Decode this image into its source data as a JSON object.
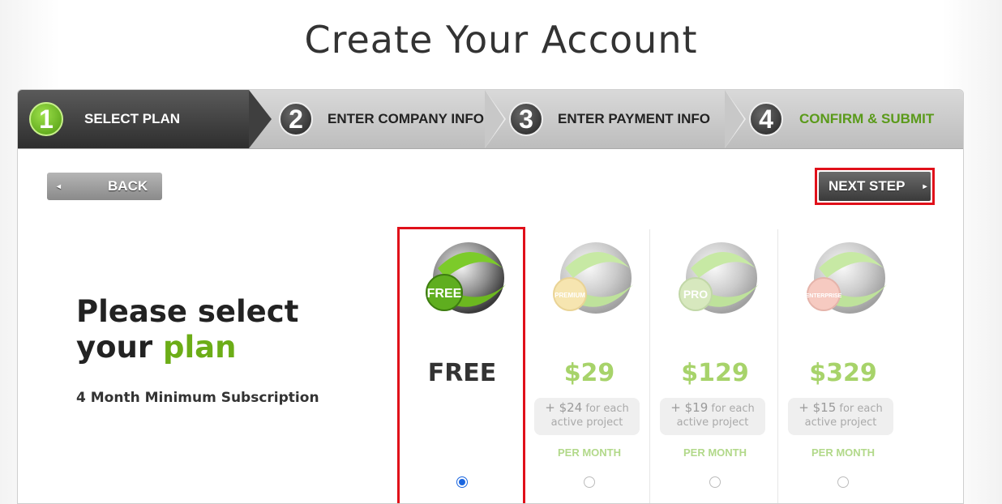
{
  "page": {
    "title": "Create Your Account"
  },
  "steps": [
    {
      "number": "1",
      "label": "SELECT PLAN",
      "state": "active"
    },
    {
      "number": "2",
      "label": "ENTER COMPANY INFO",
      "state": "pending"
    },
    {
      "number": "3",
      "label": "ENTER PAYMENT INFO",
      "state": "pending"
    },
    {
      "number": "4",
      "label": "CONFIRM & SUBMIT",
      "state": "final"
    }
  ],
  "nav": {
    "back_label": "BACK",
    "next_label": "NEXT STEP"
  },
  "intro": {
    "line1": "Please select",
    "line2_prefix": "your ",
    "line2_highlight": "plan",
    "subtitle": "4 Month Minimum Subscription"
  },
  "plans": [
    {
      "badge": "FREE",
      "price": "FREE",
      "fee_amount": "",
      "fee_text": "",
      "period": "",
      "selected": true,
      "badge_color": "#5fae1f"
    },
    {
      "badge": "PREMIUM",
      "price": "$29",
      "fee_amount": "+ $24",
      "fee_text_a": "for each",
      "fee_text_b": "active project",
      "period": "PER MONTH",
      "selected": false,
      "badge_color": "#f0d070"
    },
    {
      "badge": "PRO",
      "price": "$129",
      "fee_amount": "+ $19",
      "fee_text_a": "for each",
      "fee_text_b": "active project",
      "period": "PER MONTH",
      "selected": false,
      "badge_color": "#b8d68a"
    },
    {
      "badge": "ENTERPRISE",
      "price": "$329",
      "fee_amount": "+ $15",
      "fee_text_a": "for each",
      "fee_text_b": "active project",
      "period": "PER MONTH",
      "selected": false,
      "badge_color": "#f0a090"
    }
  ],
  "colors": {
    "accent_green": "#6cad17",
    "selection_red": "#e0101a",
    "radio_blue": "#1a66e0"
  }
}
